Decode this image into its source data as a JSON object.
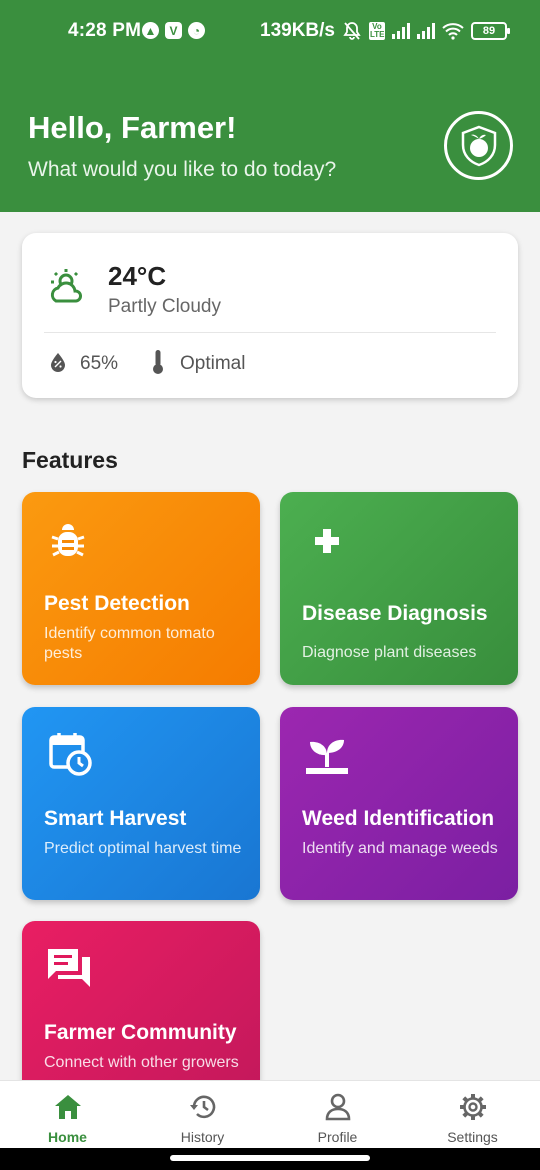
{
  "status_bar": {
    "time": "4:28 PM",
    "network_speed": "139KB/s",
    "volte_label": "Vo LTE",
    "battery": "89"
  },
  "header": {
    "greeting": "Hello, Farmer!",
    "subtitle": "What would you like to do today?",
    "logo_icon": "tomato-shield-icon",
    "color": "#3a8f3e"
  },
  "weather": {
    "temperature": "24°C",
    "condition": "Partly Cloudy",
    "humidity": "65%",
    "soil_status": "Optimal",
    "icon": "partly-cloudy-icon"
  },
  "features": {
    "title": "Features",
    "cards": [
      {
        "title": "Pest Detection",
        "description": "Identify common tomato pests",
        "icon": "bug-icon",
        "color": "#f57c00"
      },
      {
        "title": "Disease Diagnosis",
        "description": "Diagnose plant diseases",
        "icon": "medical-cross-icon",
        "color": "#388e3c"
      },
      {
        "title": "Smart Harvest",
        "description": "Predict optimal harvest time",
        "icon": "calendar-clock-icon",
        "color": "#1976d2"
      },
      {
        "title": "Weed Identification",
        "description": "Identify and manage weeds",
        "icon": "sprout-icon",
        "color": "#7b1fa2"
      },
      {
        "title": "Farmer Community",
        "description": "Connect with other growers",
        "icon": "chat-bubbles-icon",
        "color": "#c2185b"
      }
    ]
  },
  "bottom_nav": {
    "items": [
      {
        "label": "Home",
        "icon": "home-icon",
        "active": true
      },
      {
        "label": "History",
        "icon": "history-icon",
        "active": false
      },
      {
        "label": "Profile",
        "icon": "person-icon",
        "active": false
      },
      {
        "label": "Settings",
        "icon": "gear-icon",
        "active": false
      }
    ]
  }
}
